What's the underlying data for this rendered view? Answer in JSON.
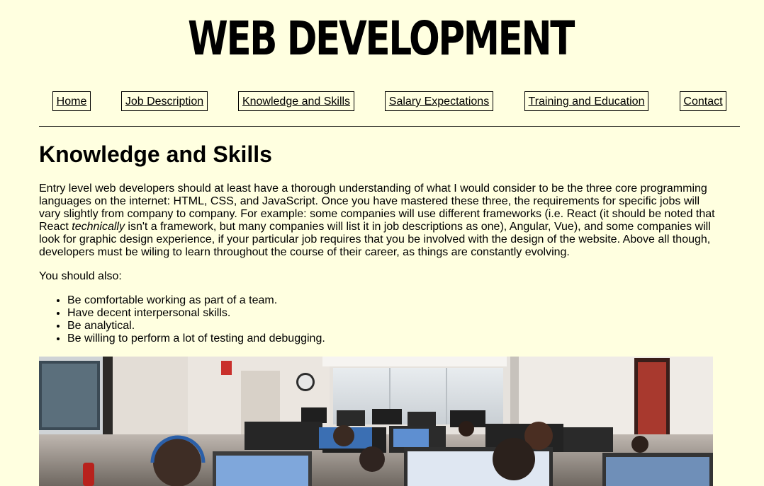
{
  "header": {
    "site_title": "WEB DEVELOPMENT"
  },
  "nav": {
    "items": [
      {
        "label": "Home"
      },
      {
        "label": "Job Description"
      },
      {
        "label": "Knowledge and Skills"
      },
      {
        "label": "Salary Expectations"
      },
      {
        "label": "Training and Education"
      },
      {
        "label": "Contact"
      }
    ]
  },
  "main": {
    "heading": "Knowledge and Skills",
    "intro_before": "Entry level web developers should at least have a thorough understanding of what I would consider to be the three core programming languages on the internet: HTML, CSS, and JavaScript. Once you have mastered these three, the requirements for specific jobs will vary slightly from company to company. For example: some companies will use different frameworks (i.e. React (it should be noted that React ",
    "intro_emphasis": "technically",
    "intro_after": " isn't a framework, but many companies will list it in job descriptions as one), Angular, Vue), and some companies will look for graphic design experience, if your particular job requires that you be involved with the design of the website. Above all though, developers must be wiling to learn throughout the course of their career, as things are constantly evolving.",
    "also_label": "You should also:",
    "skills": [
      "Be comfortable working as part of a team.",
      "Have decent interpersonal skills.",
      "Be analytical.",
      "Be willing to perform a lot of testing and debugging."
    ]
  },
  "colors": {
    "page_background": "#ffffe0",
    "text": "#000000"
  }
}
